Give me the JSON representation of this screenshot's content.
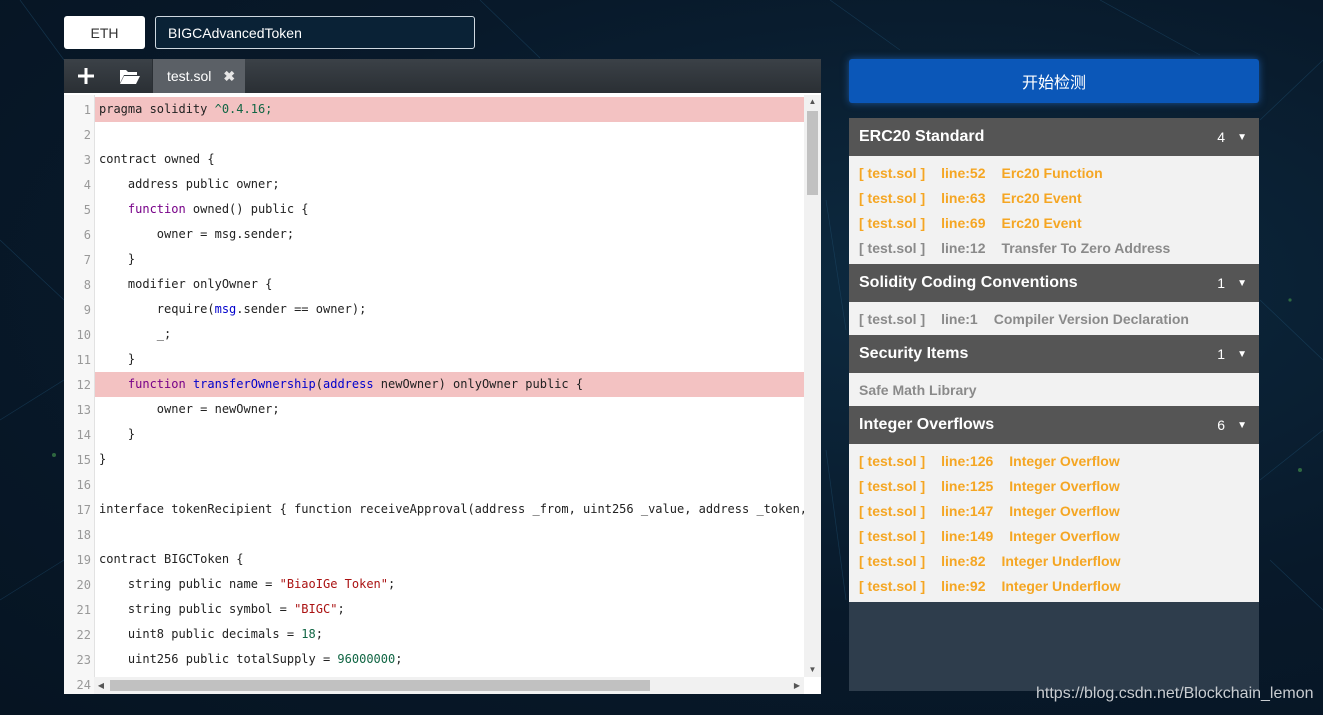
{
  "chain_selector": {
    "label": "ETH"
  },
  "contract_name_input": {
    "value": "BIGCAdvancedToken"
  },
  "editor": {
    "tab": {
      "label": "test.sol",
      "close": "✖"
    },
    "lines": [
      {
        "n": "1",
        "hl": true,
        "tokens": [
          [
            "",
            "pragma solidity "
          ],
          [
            "nm",
            "^0.4.16;"
          ]
        ]
      },
      {
        "n": "2",
        "hl": false,
        "tokens": []
      },
      {
        "n": "3",
        "hl": false,
        "tokens": [
          [
            "",
            "contract owned {"
          ]
        ]
      },
      {
        "n": "4",
        "hl": false,
        "tokens": [
          [
            "",
            "    address public owner;"
          ]
        ]
      },
      {
        "n": "5",
        "hl": false,
        "tokens": [
          [
            "kw",
            "    function"
          ],
          [
            "",
            " owned() public {"
          ]
        ]
      },
      {
        "n": "6",
        "hl": false,
        "tokens": [
          [
            "",
            "        owner = msg.sender;"
          ]
        ]
      },
      {
        "n": "7",
        "hl": false,
        "tokens": [
          [
            "",
            "    }"
          ]
        ]
      },
      {
        "n": "8",
        "hl": false,
        "tokens": [
          [
            "",
            "    modifier onlyOwner {"
          ]
        ]
      },
      {
        "n": "9",
        "hl": false,
        "tokens": [
          [
            "",
            "        require("
          ],
          [
            "mg",
            "msg"
          ],
          [
            "",
            ".sender == owner);"
          ]
        ]
      },
      {
        "n": "10",
        "hl": false,
        "tokens": [
          [
            "",
            "        _;"
          ]
        ]
      },
      {
        "n": "11",
        "hl": false,
        "tokens": [
          [
            "",
            "    }"
          ]
        ]
      },
      {
        "n": "12",
        "hl": true,
        "tokens": [
          [
            "kw",
            "    function"
          ],
          [
            "",
            " "
          ],
          [
            "fn",
            "transferOwnership"
          ],
          [
            "",
            "("
          ],
          [
            "tp",
            "address"
          ],
          [
            "",
            " newOwner) onlyOwner public {"
          ]
        ]
      },
      {
        "n": "13",
        "hl": false,
        "tokens": [
          [
            "",
            "        owner = newOwner;"
          ]
        ]
      },
      {
        "n": "14",
        "hl": false,
        "tokens": [
          [
            "",
            "    }"
          ]
        ]
      },
      {
        "n": "15",
        "hl": false,
        "tokens": [
          [
            "",
            "}"
          ]
        ]
      },
      {
        "n": "16",
        "hl": false,
        "tokens": []
      },
      {
        "n": "17",
        "hl": false,
        "tokens": [
          [
            "",
            "interface tokenRecipient { function receiveApproval(address _from, uint256 _value, address _token, by"
          ]
        ]
      },
      {
        "n": "18",
        "hl": false,
        "tokens": []
      },
      {
        "n": "19",
        "hl": false,
        "tokens": [
          [
            "",
            "contract BIGCToken {"
          ]
        ]
      },
      {
        "n": "20",
        "hl": false,
        "tokens": [
          [
            "",
            "    string public name = "
          ],
          [
            "st",
            "\"BiaoIGe Token\""
          ],
          [
            "",
            ";"
          ]
        ]
      },
      {
        "n": "21",
        "hl": false,
        "tokens": [
          [
            "",
            "    string public symbol = "
          ],
          [
            "st",
            "\"BIGC\""
          ],
          [
            "",
            ";"
          ]
        ]
      },
      {
        "n": "22",
        "hl": false,
        "tokens": [
          [
            "",
            "    uint8 public decimals = "
          ],
          [
            "nm",
            "18"
          ],
          [
            "",
            ";"
          ]
        ]
      },
      {
        "n": "23",
        "hl": false,
        "tokens": [
          [
            "",
            "    uint256 public totalSupply = "
          ],
          [
            "nm",
            "96000000"
          ],
          [
            "",
            ";"
          ]
        ]
      },
      {
        "n": "24",
        "hl": false,
        "tokens": []
      }
    ]
  },
  "detect_button": {
    "label": "开始检测"
  },
  "results": {
    "sections": [
      {
        "title": "ERC20 Standard",
        "count": "4",
        "items": [
          {
            "file": "[ test.sol ]",
            "line": "line:52",
            "desc": "Erc20 Function",
            "level": "warn"
          },
          {
            "file": "[ test.sol ]",
            "line": "line:63",
            "desc": "Erc20 Event",
            "level": "warn"
          },
          {
            "file": "[ test.sol ]",
            "line": "line:69",
            "desc": "Erc20 Event",
            "level": "warn"
          },
          {
            "file": "[ test.sol ]",
            "line": "line:12",
            "desc": "Transfer To Zero Address",
            "level": "info"
          }
        ]
      },
      {
        "title": "Solidity Coding Conventions",
        "count": "1",
        "items": [
          {
            "file": "[ test.sol ]",
            "line": "line:1",
            "desc": "Compiler Version Declaration",
            "level": "info"
          }
        ]
      },
      {
        "title": "Security Items",
        "count": "1",
        "items": [
          {
            "file": "",
            "line": "",
            "desc": "Safe Math Library",
            "level": "info"
          }
        ]
      },
      {
        "title": "Integer Overflows",
        "count": "6",
        "items": [
          {
            "file": "[ test.sol ]",
            "line": "line:126",
            "desc": "Integer Overflow",
            "level": "warn"
          },
          {
            "file": "[ test.sol ]",
            "line": "line:125",
            "desc": "Integer Overflow",
            "level": "warn"
          },
          {
            "file": "[ test.sol ]",
            "line": "line:147",
            "desc": "Integer Overflow",
            "level": "warn"
          },
          {
            "file": "[ test.sol ]",
            "line": "line:149",
            "desc": "Integer Overflow",
            "level": "warn"
          },
          {
            "file": "[ test.sol ]",
            "line": "line:82",
            "desc": "Integer Underflow",
            "level": "warn"
          },
          {
            "file": "[ test.sol ]",
            "line": "line:92",
            "desc": "Integer Underflow",
            "level": "warn"
          }
        ]
      }
    ]
  },
  "watermark": "https://blog.csdn.net/Blockchain_lemon",
  "colors": {
    "detect_button": "#0b57b8",
    "warning_text": "#f5a623",
    "info_text": "#8a8a8a",
    "highlight_line": "#f3c2c2",
    "section_header": "#555555"
  },
  "icons": {
    "new_file": "plus-icon",
    "open_file": "folder-open-icon",
    "close_tab": "close-icon",
    "section_toggle": "caret-down-icon"
  }
}
